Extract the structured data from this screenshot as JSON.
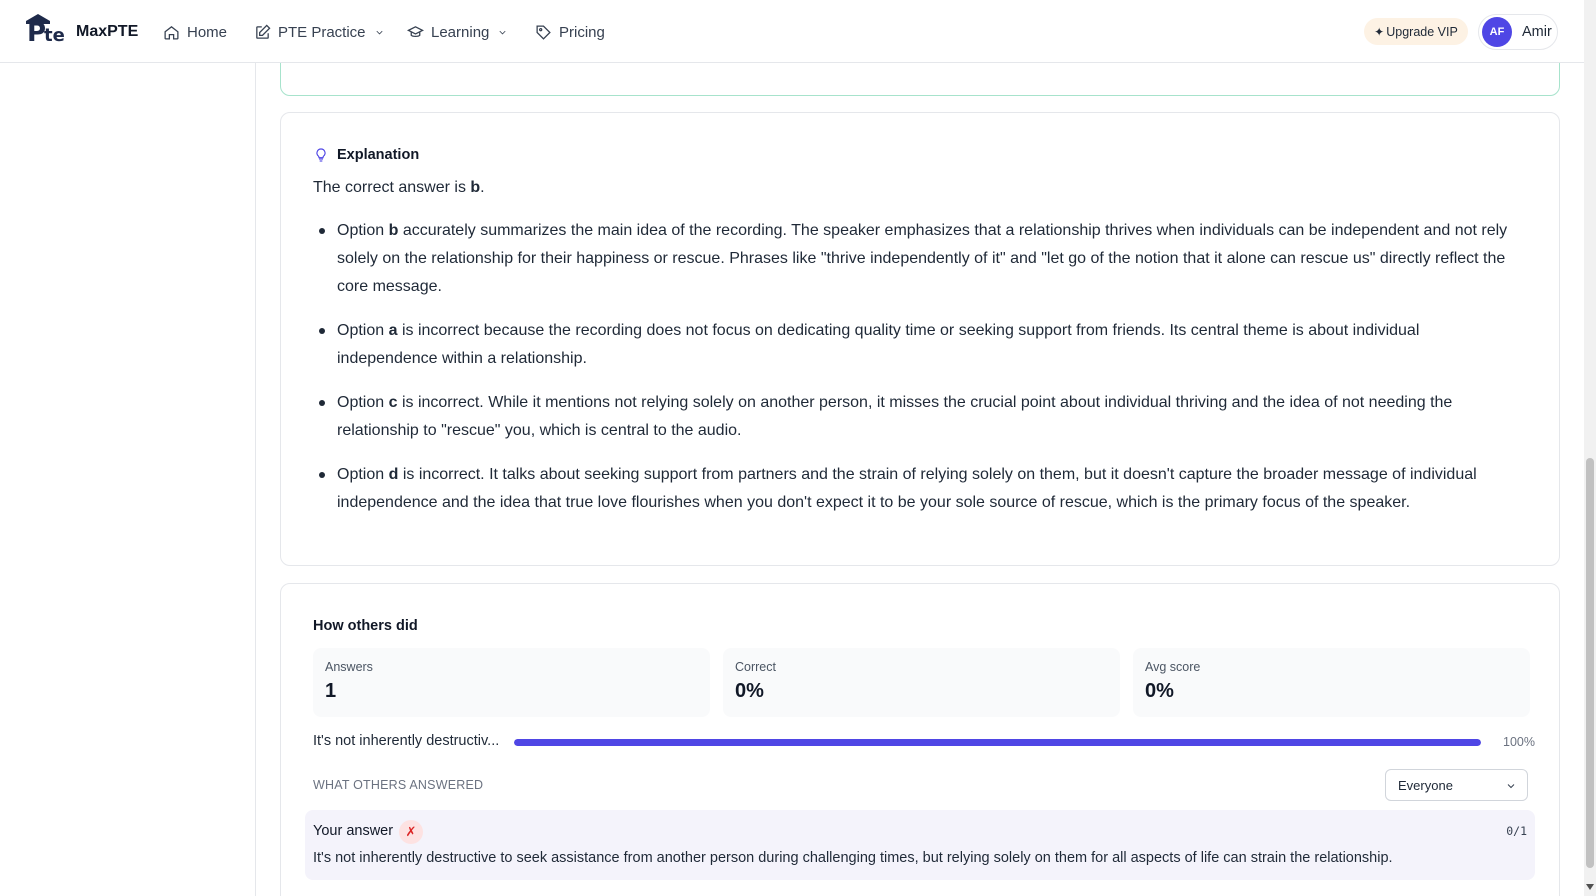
{
  "nav": {
    "brand": "MaxPTE",
    "home": "Home",
    "practice": "PTE Practice",
    "learning": "Learning",
    "pricing": "Pricing",
    "upgrade": "Upgrade VIP",
    "upgrade_icon": "✦",
    "avatar_initials": "AF",
    "username": "Amir"
  },
  "explanation": {
    "title": "Explanation",
    "lead_prefix": "The correct answer is ",
    "lead_answer": "b",
    "lead_suffix": ".",
    "items": [
      {
        "prefix": "Option ",
        "option": "b",
        "text": " accurately summarizes the main idea of the recording. The speaker emphasizes that a relationship thrives when individuals can be independent and not rely solely on the relationship for their happiness or rescue. Phrases like \"thrive independently of it\" and \"let go of the notion that it alone can rescue us\" directly reflect the core message."
      },
      {
        "prefix": "Option ",
        "option": "a",
        "text": " is incorrect because the recording does not focus on dedicating quality time or seeking support from friends. Its central theme is about individual independence within a relationship."
      },
      {
        "prefix": "Option ",
        "option": "c",
        "text": " is incorrect. While it mentions not relying solely on another person, it misses the crucial point about individual thriving and the idea of not needing the relationship to \"rescue\" you, which is central to the audio."
      },
      {
        "prefix": "Option ",
        "option": "d",
        "text": " is incorrect. It talks about seeking support from partners and the strain of relying solely on them, but it doesn't capture the broader message of individual independence and the idea that true love flourishes when you don't expect it to be your sole source of rescue, which is the primary focus of the speaker."
      }
    ]
  },
  "stats": {
    "title": "How others did",
    "answers_label": "Answers",
    "answers_value": "1",
    "correct_label": "Correct",
    "correct_value": "0%",
    "avg_label": "Avg score",
    "avg_value": "0%",
    "distribution": {
      "label": "It's not inherently destructiv...",
      "percent_text": "100%",
      "fraction": 1.0
    },
    "others_label": "WHAT OTHERS ANSWERED",
    "filter_selected": "Everyone",
    "your_answer": {
      "title": "Your answer",
      "mark": "✗",
      "score": "0/1",
      "text": "It's not inherently destructive to seek assistance from another person during challenging times, but relying solely on them for all aspects of life can strain the relationship."
    }
  },
  "colors": {
    "accent": "#4f46e5",
    "success_border": "#a7e3cc",
    "error": "#dc2626",
    "upgrade_bg": "#fdf2e4"
  }
}
